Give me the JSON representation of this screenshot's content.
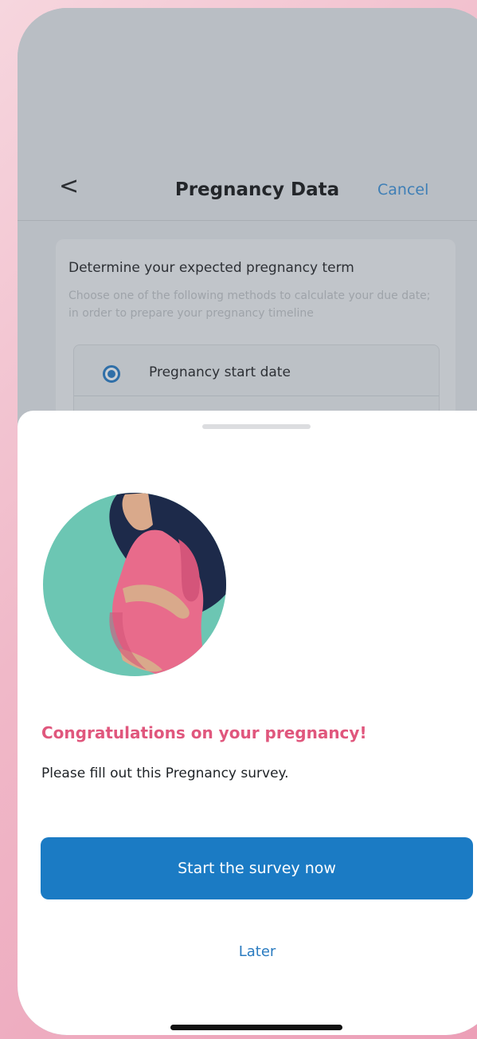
{
  "nav": {
    "back_label": "<",
    "title": "Pregnancy Data",
    "cancel_label": "Cancel"
  },
  "card": {
    "title": "Determine your expected pregnancy term",
    "description": "Choose one of the following methods to calculate your due date; in order to prepare your pregnancy timeline",
    "options": [
      {
        "label": "Pregnancy start date",
        "selected": true
      }
    ]
  },
  "sheet": {
    "illustration": "pregnant-woman-illustration",
    "headline": "Congratulations on your pregnancy!",
    "subtitle": "Please fill out this Pregnancy survey.",
    "primary_button": "Start the survey now",
    "secondary_button": "Later"
  },
  "colors": {
    "accent_blue": "#1b7bc4",
    "headline_pink": "#e0577d",
    "illustration_teal": "#6cc6b3",
    "illustration_pink": "#e86b8b",
    "hair_navy": "#1d2a4a",
    "skin": "#d9a98b"
  }
}
